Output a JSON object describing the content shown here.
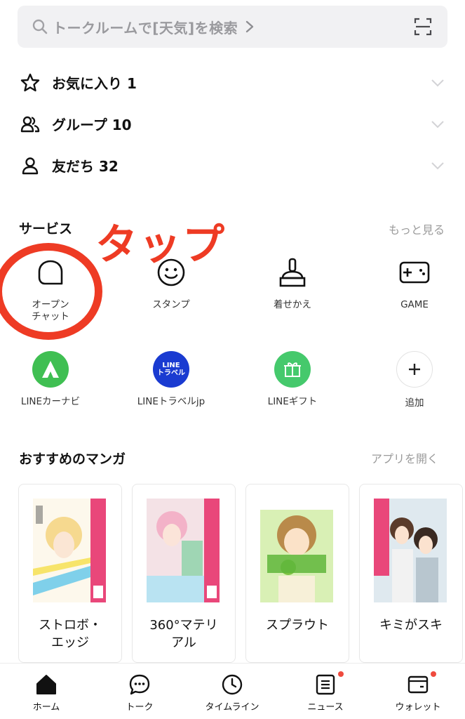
{
  "search": {
    "query": "トークルームで[天気]を検索",
    "icon": "search-icon",
    "scan_icon": "qr-scan-icon"
  },
  "rows": [
    {
      "label": "お気に入り 1",
      "icon": "star-icon"
    },
    {
      "label": "グループ 10",
      "icon": "group-icon"
    },
    {
      "label": "友だち 32",
      "icon": "person-icon"
    }
  ],
  "services": {
    "title": "サービス",
    "more": "もっと見る",
    "items": [
      {
        "label": "オープン\nチャット",
        "icon": "open-chat-icon"
      },
      {
        "label": "スタンプ",
        "icon": "smiley-icon"
      },
      {
        "label": "着せかえ",
        "icon": "brush-icon"
      },
      {
        "label": "GAME",
        "icon": "gamepad-icon"
      },
      {
        "label": "LINEカーナビ",
        "icon": "line-car-navi-icon",
        "color": "#3fbf52"
      },
      {
        "label": "LINEトラベルjp",
        "icon": "line-travel-icon",
        "color": "#1a3bd1",
        "badge_text": "LINE\nトラベル"
      },
      {
        "label": "LINEギフト",
        "icon": "gift-icon",
        "color": "#45c96c"
      },
      {
        "label": "追加",
        "icon": "plus-icon"
      }
    ]
  },
  "annotation": {
    "text": "タップ",
    "color": "#ee3b24"
  },
  "manga": {
    "title": "おすすめのマンガ",
    "open_app": "アプリを開く",
    "items": [
      {
        "title": "ストロボ・\nエッジ"
      },
      {
        "title": "360°マテリ\nアル"
      },
      {
        "title": "スプラウト"
      },
      {
        "title": "キミがスキ"
      }
    ]
  },
  "nav": {
    "tabs": [
      {
        "label": "ホーム",
        "icon": "home-icon",
        "active": true
      },
      {
        "label": "トーク",
        "icon": "chat-bubble-icon"
      },
      {
        "label": "タイムライン",
        "icon": "clock-icon"
      },
      {
        "label": "ニュース",
        "icon": "news-icon",
        "badge": true
      },
      {
        "label": "ウォレット",
        "icon": "wallet-icon",
        "badge": true
      }
    ]
  }
}
